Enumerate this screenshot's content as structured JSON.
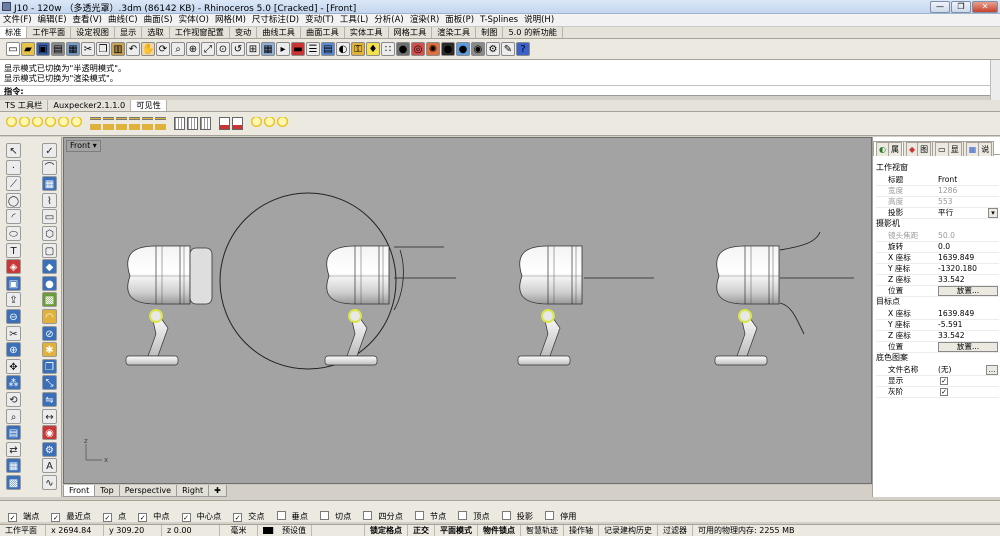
{
  "window": {
    "title": "J10 - 120w （多透光罩）.3dm (86142 KB) - Rhinoceros 5.0 [Cracked] - [Front]",
    "minimize": "—",
    "maximize": "❐",
    "close": "✕"
  },
  "menu": [
    "文件(F)",
    "编辑(E)",
    "查看(V)",
    "曲线(C)",
    "曲面(S)",
    "实体(O)",
    "网格(M)",
    "尺寸标注(D)",
    "变动(T)",
    "工具(L)",
    "分析(A)",
    "渲染(R)",
    "面板(P)",
    "T-Splines",
    "说明(H)"
  ],
  "toolbar_tabs": [
    "标准",
    "工作平面",
    "设定视图",
    "显示",
    "选取",
    "工作视窗配置",
    "变动",
    "曲线工具",
    "曲面工具",
    "实体工具",
    "网格工具",
    "渲染工具",
    "制图",
    "5.0 的新功能"
  ],
  "toolbar_icons": [
    {
      "name": "new-file-icon",
      "glyph": "▭",
      "color": "#ffffff"
    },
    {
      "name": "open-folder-icon",
      "glyph": "▰",
      "color": "#e8c34a"
    },
    {
      "name": "save-icon",
      "glyph": "▣",
      "color": "#3b5ea8"
    },
    {
      "name": "print-icon",
      "glyph": "▤",
      "color": "#8a8a8a"
    },
    {
      "name": "import-icon",
      "glyph": "▦",
      "color": "#7a9cc8"
    },
    {
      "name": "cut-icon",
      "glyph": "✂",
      "color": "#ececec"
    },
    {
      "name": "copy-icon",
      "glyph": "❐",
      "color": "#ececec"
    },
    {
      "name": "paste-icon",
      "glyph": "▥",
      "color": "#c9a25a"
    },
    {
      "name": "undo-icon",
      "glyph": "↶",
      "color": "#ececec"
    },
    {
      "name": "pan-hand-icon",
      "glyph": "✋",
      "color": "#f1d7a8"
    },
    {
      "name": "rotate-view-icon",
      "glyph": "⟳",
      "color": "#ececec"
    },
    {
      "name": "zoom-icon",
      "glyph": "⌕",
      "color": "#ececec"
    },
    {
      "name": "zoom-window-icon",
      "glyph": "⊕",
      "color": "#ececec"
    },
    {
      "name": "zoom-extents-icon",
      "glyph": "⤢",
      "color": "#ececec"
    },
    {
      "name": "zoom-selected-icon",
      "glyph": "⊙",
      "color": "#ececec"
    },
    {
      "name": "undo-view-icon",
      "glyph": "↺",
      "color": "#ececec"
    },
    {
      "name": "four-views-icon",
      "glyph": "⊞",
      "color": "#ececec"
    },
    {
      "name": "cplane-icon",
      "glyph": "▦",
      "color": "#8fb0d8"
    },
    {
      "name": "select-icon",
      "glyph": "▸",
      "color": "#ececec"
    },
    {
      "name": "car-icon",
      "glyph": "▬",
      "color": "#cc3333"
    },
    {
      "name": "properties-icon",
      "glyph": "☰",
      "color": "#ececec"
    },
    {
      "name": "layer-icon",
      "glyph": "▤",
      "color": "#5c8ad0"
    },
    {
      "name": "hide-icon",
      "glyph": "◐",
      "color": "#ececec"
    },
    {
      "name": "lock-icon",
      "glyph": "⚿",
      "color": "#e0b23c"
    },
    {
      "name": "light-icon",
      "glyph": "♦",
      "color": "#f4e04a"
    },
    {
      "name": "point-edit-icon",
      "glyph": "∷",
      "color": "#ececec"
    },
    {
      "name": "material-icon",
      "glyph": "●",
      "color": "#6f6f6f"
    },
    {
      "name": "render-icon",
      "glyph": "◎",
      "color": "#d05050"
    },
    {
      "name": "color-wheel-icon",
      "glyph": "✺",
      "color": "#e07040"
    },
    {
      "name": "ball-icon",
      "glyph": "●",
      "color": "#2a2a2a"
    },
    {
      "name": "sphere-icon",
      "glyph": "●",
      "color": "#5c9ce0"
    },
    {
      "name": "render-preview-icon",
      "glyph": "◉",
      "color": "#8a8a8a"
    },
    {
      "name": "options-icon",
      "glyph": "⚙",
      "color": "#ececec"
    },
    {
      "name": "tools-icon",
      "glyph": "✎",
      "color": "#ececec"
    },
    {
      "name": "help-icon",
      "glyph": "?",
      "color": "#3a62c8"
    }
  ],
  "command_history": [
    "显示模式已切换为\"半透明模式\"。",
    "显示模式已切换为\"渲染模式\"。"
  ],
  "command_prompt": "指令:",
  "panel_tabs": [
    "TS 工具栏",
    "Auxpecker2.1.1.0",
    "可见性"
  ],
  "visibility_icons": [
    "light-bulb-icon",
    "light-bulb-icon",
    "light-bulb-icon",
    "light-bulb-icon",
    "light-bulb-icon",
    "light-bulb-icon",
    "lock-icon",
    "lock-icon",
    "lock-icon",
    "lock-icon",
    "lock-icon",
    "lock-icon",
    "grid-lock-icon",
    "grid-lock-icon",
    "grid-lock-icon",
    "display-object-icon",
    "display-object-icon",
    "light-bulb-icon",
    "light-bulb-icon",
    "light-bulb-icon"
  ],
  "left_tools": [
    "select-arrow-icon",
    "check-icon",
    "point-icon",
    "curve-icon",
    "polyline-icon",
    "grid-icon",
    "circle-icon",
    "curve-edit-icon",
    "arc-icon",
    "rectangle-icon",
    "ellipse-icon",
    "polygon-icon",
    "text-icon",
    "rectangle-tool-icon",
    "surface-icon",
    "solid-icon",
    "box-icon",
    "sphere-tool-icon",
    "extrude-icon",
    "mesh-icon",
    "boolean-icon",
    "fillet-icon",
    "trim-icon",
    "split-icon",
    "join-icon",
    "explode-icon",
    "move-icon",
    "copy-tool-icon",
    "array-icon",
    "scale-icon",
    "rotate-tool-icon",
    "mirror-icon",
    "analyze-icon",
    "dimension-icon",
    "layer-tool-icon",
    "render-tool-icon",
    "transform-icon",
    "tools-icon",
    "cplane-tool-icon",
    "text-tool-icon",
    "block-icon",
    "curve-tool-icon"
  ],
  "viewport": {
    "name": "Front",
    "axis_y": "z",
    "axis_x": "x",
    "tabs": [
      "Front",
      "Top",
      "Perspective",
      "Right"
    ],
    "active_tab": "Front",
    "add_tab": "✚"
  },
  "properties": {
    "tabs": [
      "属",
      "图",
      "显",
      "说"
    ],
    "viewport_section": "工作视窗",
    "viewport_rows": [
      {
        "k": "标题",
        "v": "Front",
        "dim": false
      },
      {
        "k": "宽度",
        "v": "1286",
        "dim": true
      },
      {
        "k": "高度",
        "v": "553",
        "dim": true
      },
      {
        "k": "投影",
        "v": "平行",
        "dim": false,
        "dropdown": true
      }
    ],
    "camera_section": "摄影机",
    "camera_rows": [
      {
        "k": "镜头焦距",
        "v": "50.0",
        "dim": true
      },
      {
        "k": "旋转",
        "v": "0.0",
        "dim": false
      },
      {
        "k": "X 座标",
        "v": "1639.849",
        "dim": false
      },
      {
        "k": "Y 座标",
        "v": "-1320.180",
        "dim": false
      },
      {
        "k": "Z 座标",
        "v": "33.542",
        "dim": false
      },
      {
        "k": "位置",
        "v": "",
        "button": "放置...",
        "dim": false
      }
    ],
    "target_section": "目标点",
    "target_rows": [
      {
        "k": "X 座标",
        "v": "1639.849",
        "dim": false
      },
      {
        "k": "Y 座标",
        "v": "-5.591",
        "dim": false
      },
      {
        "k": "Z 座标",
        "v": "33.542",
        "dim": false
      },
      {
        "k": "位置",
        "v": "",
        "button": "放置...",
        "dim": false
      }
    ],
    "background_section": "底色图案",
    "background_rows": [
      {
        "k": "文件名称",
        "v": "(无)",
        "dim": false,
        "ellipsis": true
      },
      {
        "k": "显示",
        "v": "",
        "check": true,
        "dim": false
      },
      {
        "k": "灰阶",
        "v": "",
        "check": true,
        "dim": false
      }
    ]
  },
  "osnaps": [
    {
      "label": "端点",
      "checked": true
    },
    {
      "label": "最近点",
      "checked": true
    },
    {
      "label": "点",
      "checked": true
    },
    {
      "label": "中点",
      "checked": true
    },
    {
      "label": "中心点",
      "checked": true
    },
    {
      "label": "交点",
      "checked": true
    },
    {
      "label": "垂点",
      "checked": false
    },
    {
      "label": "切点",
      "checked": false
    },
    {
      "label": "四分点",
      "checked": false
    },
    {
      "label": "节点",
      "checked": false
    },
    {
      "label": "顶点",
      "checked": false
    },
    {
      "label": "投影",
      "checked": false
    },
    {
      "label": "停用",
      "checked": false
    }
  ],
  "status": {
    "cplane": "工作平面",
    "x": "x 2694.84",
    "y": "y 309.20",
    "z": "z 0.00",
    "unit": "毫米",
    "layer": "预设值",
    "toggles": [
      "锁定格点",
      "正交",
      "平面模式",
      "物件锁点",
      "智慧轨迹",
      "操作轴",
      "记录建构历史",
      "过滤器"
    ],
    "memory": "可用的物理内存: 2255 MB"
  },
  "colors": {
    "viewport_bg": "#a3a3a3",
    "ui_bg": "#ece9e1",
    "selected_yellow": "#d8e64a"
  }
}
